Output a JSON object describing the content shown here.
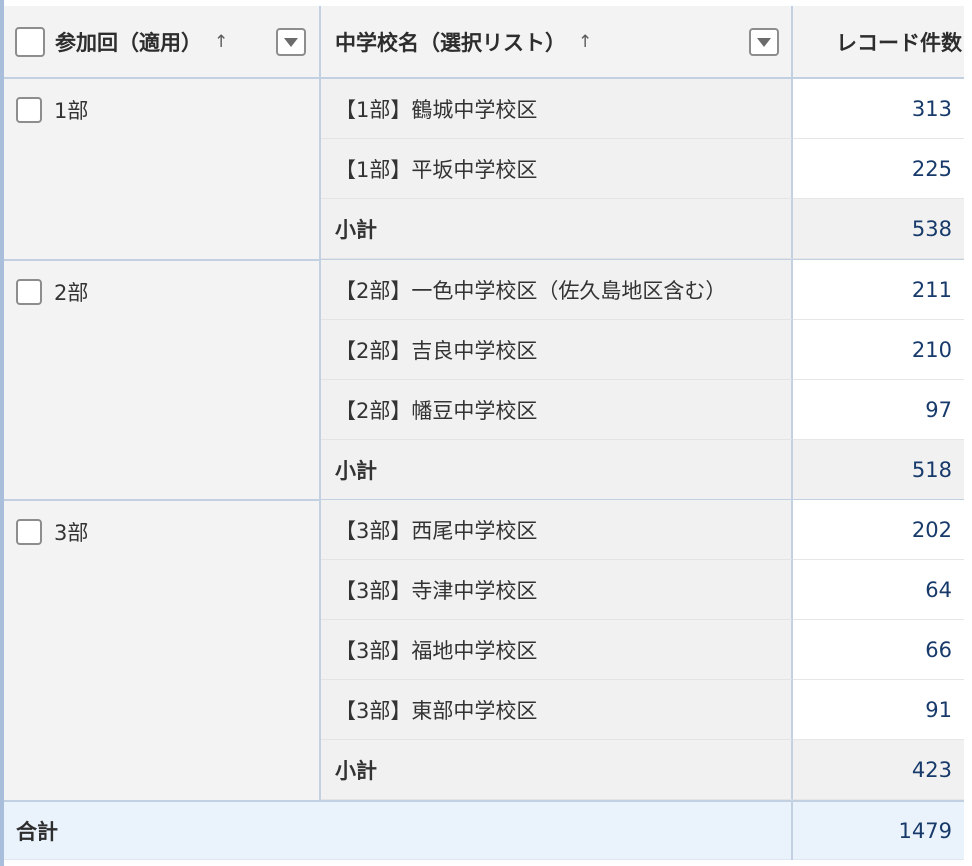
{
  "columns": {
    "participation": "参加回（適用）",
    "school": "中学校名（選択リスト）",
    "count": "レコード件数",
    "sort_arrow": "↑"
  },
  "groups": [
    {
      "label": "1部",
      "rows": [
        {
          "name": "【1部】鶴城中学校区",
          "count": "313"
        },
        {
          "name": "【1部】平坂中学校区",
          "count": "225"
        }
      ],
      "subtotal_label": "小計",
      "subtotal": "538"
    },
    {
      "label": "2部",
      "rows": [
        {
          "name": "【2部】一色中学校区（佐久島地区含む）",
          "count": "211"
        },
        {
          "name": "【2部】吉良中学校区",
          "count": "210"
        },
        {
          "name": "【2部】幡豆中学校区",
          "count": "97"
        }
      ],
      "subtotal_label": "小計",
      "subtotal": "518"
    },
    {
      "label": "3部",
      "rows": [
        {
          "name": "【3部】西尾中学校区",
          "count": "202"
        },
        {
          "name": "【3部】寺津中学校区",
          "count": "64"
        },
        {
          "name": "【3部】福地中学校区",
          "count": "66"
        },
        {
          "name": "【3部】東部中学校区",
          "count": "91"
        }
      ],
      "subtotal_label": "小計",
      "subtotal": "423"
    }
  ],
  "total": {
    "label": "合計",
    "value": "1479"
  }
}
